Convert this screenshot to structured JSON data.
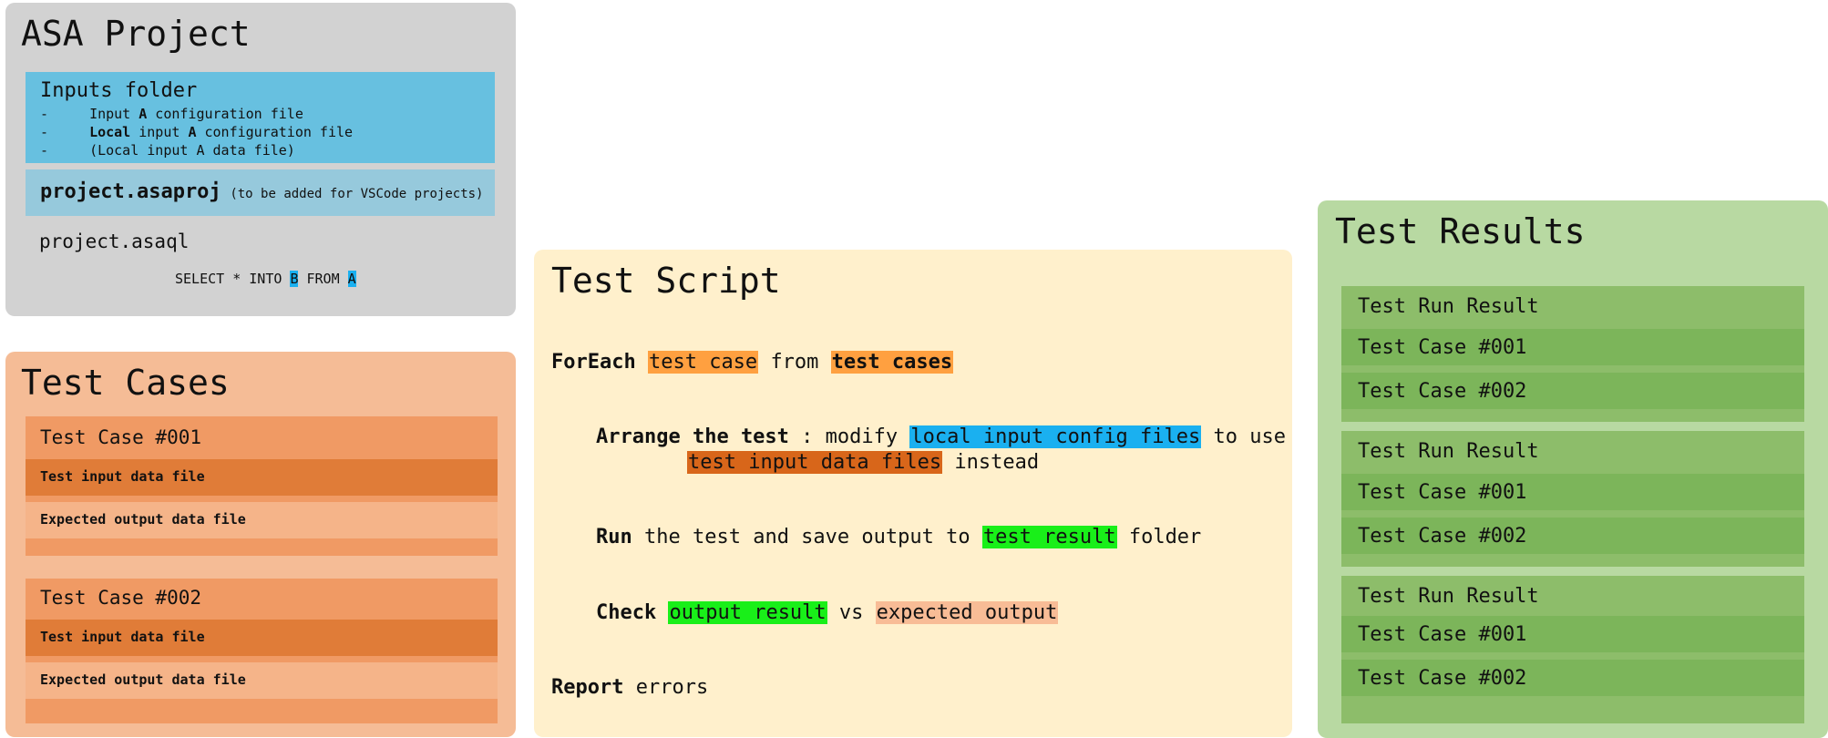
{
  "asa_project": {
    "title": "ASA Project",
    "inputs_folder": {
      "title": "Inputs folder",
      "items": [
        {
          "dash": "-",
          "pre": "Input ",
          "bold": "A",
          "post": " configuration file"
        },
        {
          "dash": "-",
          "bold_first": "Local",
          "mid": " input ",
          "bold": "A",
          "post": " configuration file"
        },
        {
          "dash": "-",
          "text": "(Local input A data file)"
        }
      ]
    },
    "asaproj": {
      "name": "project.asaproj",
      "note": "(to be added for VSCode projects)"
    },
    "asaql": {
      "name": "project.asaql",
      "query": {
        "p1": "SELECT * INTO ",
        "out": "B",
        "p2": " FROM ",
        "in": "A"
      }
    }
  },
  "test_cases": {
    "title": "Test Cases",
    "cases": [
      {
        "name": "Test Case #001",
        "input": "Test input data file",
        "expected": "Expected output data file"
      },
      {
        "name": "Test Case #002",
        "input": "Test input data file",
        "expected": "Expected output data file"
      }
    ]
  },
  "test_script": {
    "title": "Test Script",
    "foreach": {
      "kw": "ForEach",
      "a": "test case",
      "mid": "from",
      "b": "test cases"
    },
    "arrange": {
      "kw": "Arrange the test",
      "p1": ": modify",
      "hl1": "local input config files",
      "p2": "to use",
      "hl2": "test input data files",
      "p3": "instead"
    },
    "run": {
      "kw": "Run",
      "p1": "the test and save output to",
      "hl": "test result",
      "p2": "folder"
    },
    "check": {
      "kw": "Check",
      "hl1": "output result",
      "mid": "vs",
      "hl2": "expected output"
    },
    "report": {
      "kw": "Report",
      "p": "errors"
    }
  },
  "test_results": {
    "title": "Test Results",
    "runs": [
      {
        "label": "Test Run Result",
        "cases": [
          "Test Case #001",
          "Test Case #002"
        ]
      },
      {
        "label": "Test Run Result",
        "cases": [
          "Test Case #001",
          "Test Case #002"
        ]
      },
      {
        "label": "Test Run Result",
        "cases": [
          "Test Case #001",
          "Test Case #002"
        ]
      }
    ]
  },
  "colors": {
    "asa_panel": "#d2d2d2",
    "inputs_folder": "#67c0e0",
    "asaproj": "#96c9dc",
    "test_cases_panel": "#f5bc96",
    "test_case_box": "#f09a64",
    "test_script_panel": "#fff0cc",
    "test_results_panel": "#b8d9a2",
    "highlight_blue": "#1ab0f0",
    "highlight_green": "#19ef19",
    "highlight_orange": "#ffa040"
  }
}
